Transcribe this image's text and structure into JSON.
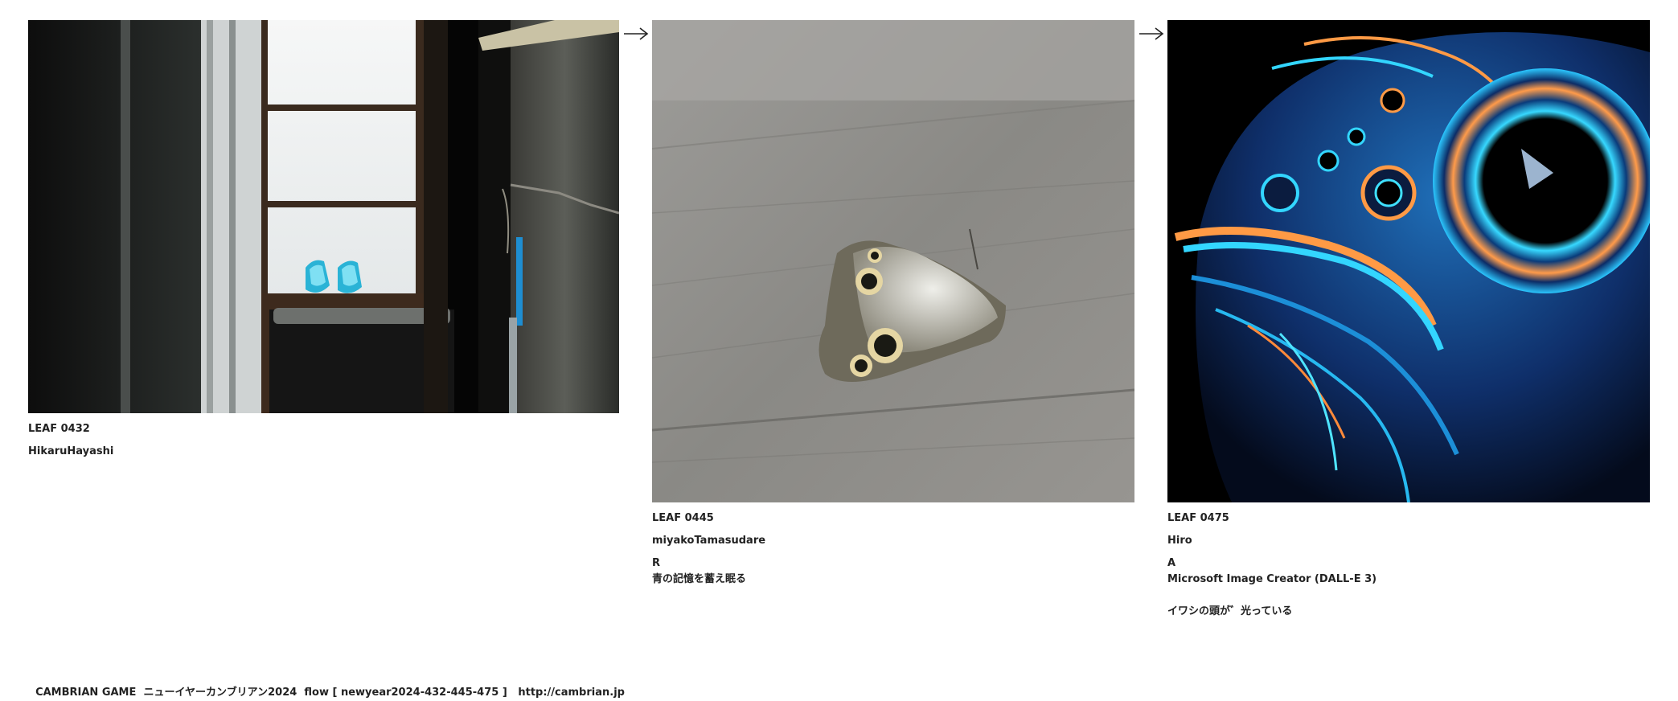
{
  "leaves": [
    {
      "id": "LEAF 0432",
      "author": "HikaruHayashi",
      "image_description": "photo-window-slippers"
    },
    {
      "id": "LEAF 0445",
      "author": "miyakoTamasudare",
      "letter": "R",
      "text": "青の記憶を蓄え眠る",
      "image_description": "photo-butterfly-wood"
    },
    {
      "id": "LEAF 0475",
      "author": "Hiro",
      "letter": "A",
      "tool": "Microsoft Image Creator (DALL-E 3)",
      "text": "イワシの頭が゛光っている",
      "image_description": "illustration-neon-fish"
    }
  ],
  "arrows": [
    "arrow-right-icon",
    "arrow-right-icon"
  ],
  "footer": {
    "game": "CAMBRIAN GAME",
    "event": "ニューイヤーカンブリアン2024",
    "flow": "flow [ newyear2024-432-445-475 ]",
    "url": "http://cambrian.jp"
  }
}
